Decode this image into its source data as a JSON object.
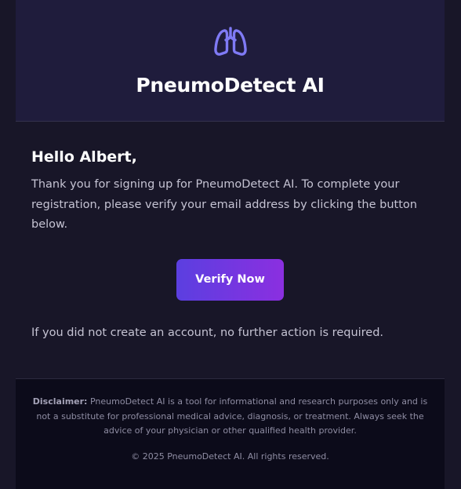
{
  "header": {
    "icon": "lungs-icon",
    "brand": "PneumoDetect AI"
  },
  "body": {
    "greeting": "Hello Albert,",
    "message": "Thank you for signing up for PneumoDetect AI. To complete your registration, please verify your email address by clicking the button below.",
    "button_label": "Verify Now",
    "note": "If you did not create an account, no further action is required."
  },
  "footer": {
    "disclaimer_label": "Disclaimer:",
    "disclaimer_text": "PneumoDetect AI is a tool for informational and research purposes only and is not a substitute for professional medical advice, diagnosis, or treatment. Always seek the advice of your physician or other qualified health provider.",
    "copyright": "© 2025 PneumoDetect AI. All rights reserved."
  },
  "colors": {
    "accent": "#7f7af5",
    "button_gradient_start": "#5b3fe0",
    "button_gradient_end": "#8b2fe0",
    "header_bg": "#1f1c3c",
    "body_bg": "#181628",
    "footer_bg": "#0c0b1a"
  }
}
